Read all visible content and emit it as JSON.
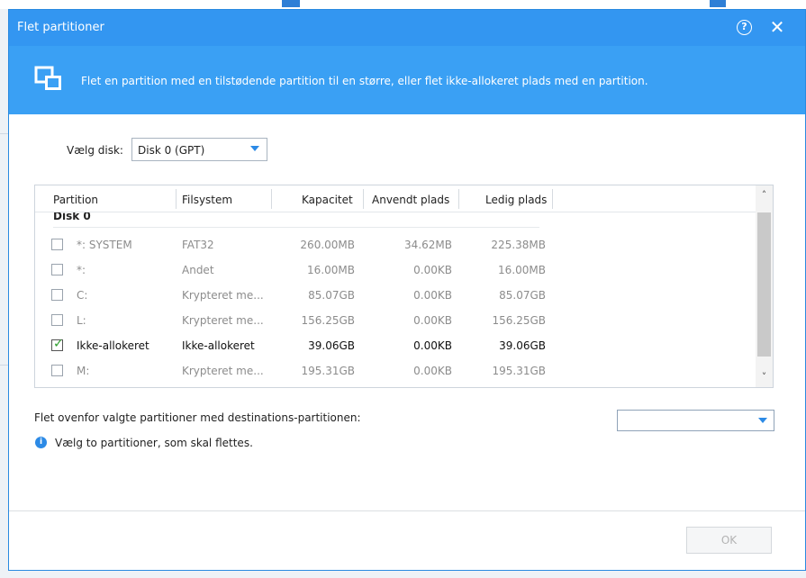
{
  "dialog": {
    "title": "Flet partitioner",
    "banner_text": "Flet en partition med en tilstødende partition til en større, eller flet ikke-allokeret plads med en partition."
  },
  "disk_selector": {
    "label": "Vælg disk:",
    "value": "Disk 0 (GPT)"
  },
  "table": {
    "headers": {
      "partition": "Partition",
      "filesystem": "Filsystem",
      "capacity": "Kapacitet",
      "used": "Anvendt plads",
      "free": "Ledig plads"
    },
    "group": "Disk 0",
    "rows": [
      {
        "partition": "*: SYSTEM",
        "filesystem": "FAT32",
        "capacity": "260.00MB",
        "used": "34.62MB",
        "free": "225.38MB",
        "checked": false
      },
      {
        "partition": "*:",
        "filesystem": "Andet",
        "capacity": "16.00MB",
        "used": "0.00KB",
        "free": "16.00MB",
        "checked": false
      },
      {
        "partition": "C:",
        "filesystem": "Krypteret me...",
        "capacity": "85.07GB",
        "used": "0.00KB",
        "free": "85.07GB",
        "checked": false
      },
      {
        "partition": "L:",
        "filesystem": "Krypteret me...",
        "capacity": "156.25GB",
        "used": "0.00KB",
        "free": "156.25GB",
        "checked": false
      },
      {
        "partition": "Ikke-allokeret",
        "filesystem": "Ikke-allokeret",
        "capacity": "39.06GB",
        "used": "0.00KB",
        "free": "39.06GB",
        "checked": true
      },
      {
        "partition": "M:",
        "filesystem": "Krypteret me...",
        "capacity": "195.31GB",
        "used": "0.00KB",
        "free": "195.31GB",
        "checked": false
      }
    ]
  },
  "merge": {
    "label": "Flet ovenfor valgte partitioner med destinations-partitionen:",
    "destination_value": "",
    "info": "Vælg to partitioner, som skal flettes."
  },
  "footer": {
    "ok_label": "OK"
  },
  "icons": {
    "help": "?",
    "close": "✕",
    "info": "i",
    "check": "✓",
    "scroll_up": "˄",
    "scroll_down": "˅"
  },
  "colors": {
    "titlebar": "#3396f1",
    "banner": "#3aa0f4",
    "accent": "#2c8ae6",
    "check": "#2e9e2e"
  }
}
